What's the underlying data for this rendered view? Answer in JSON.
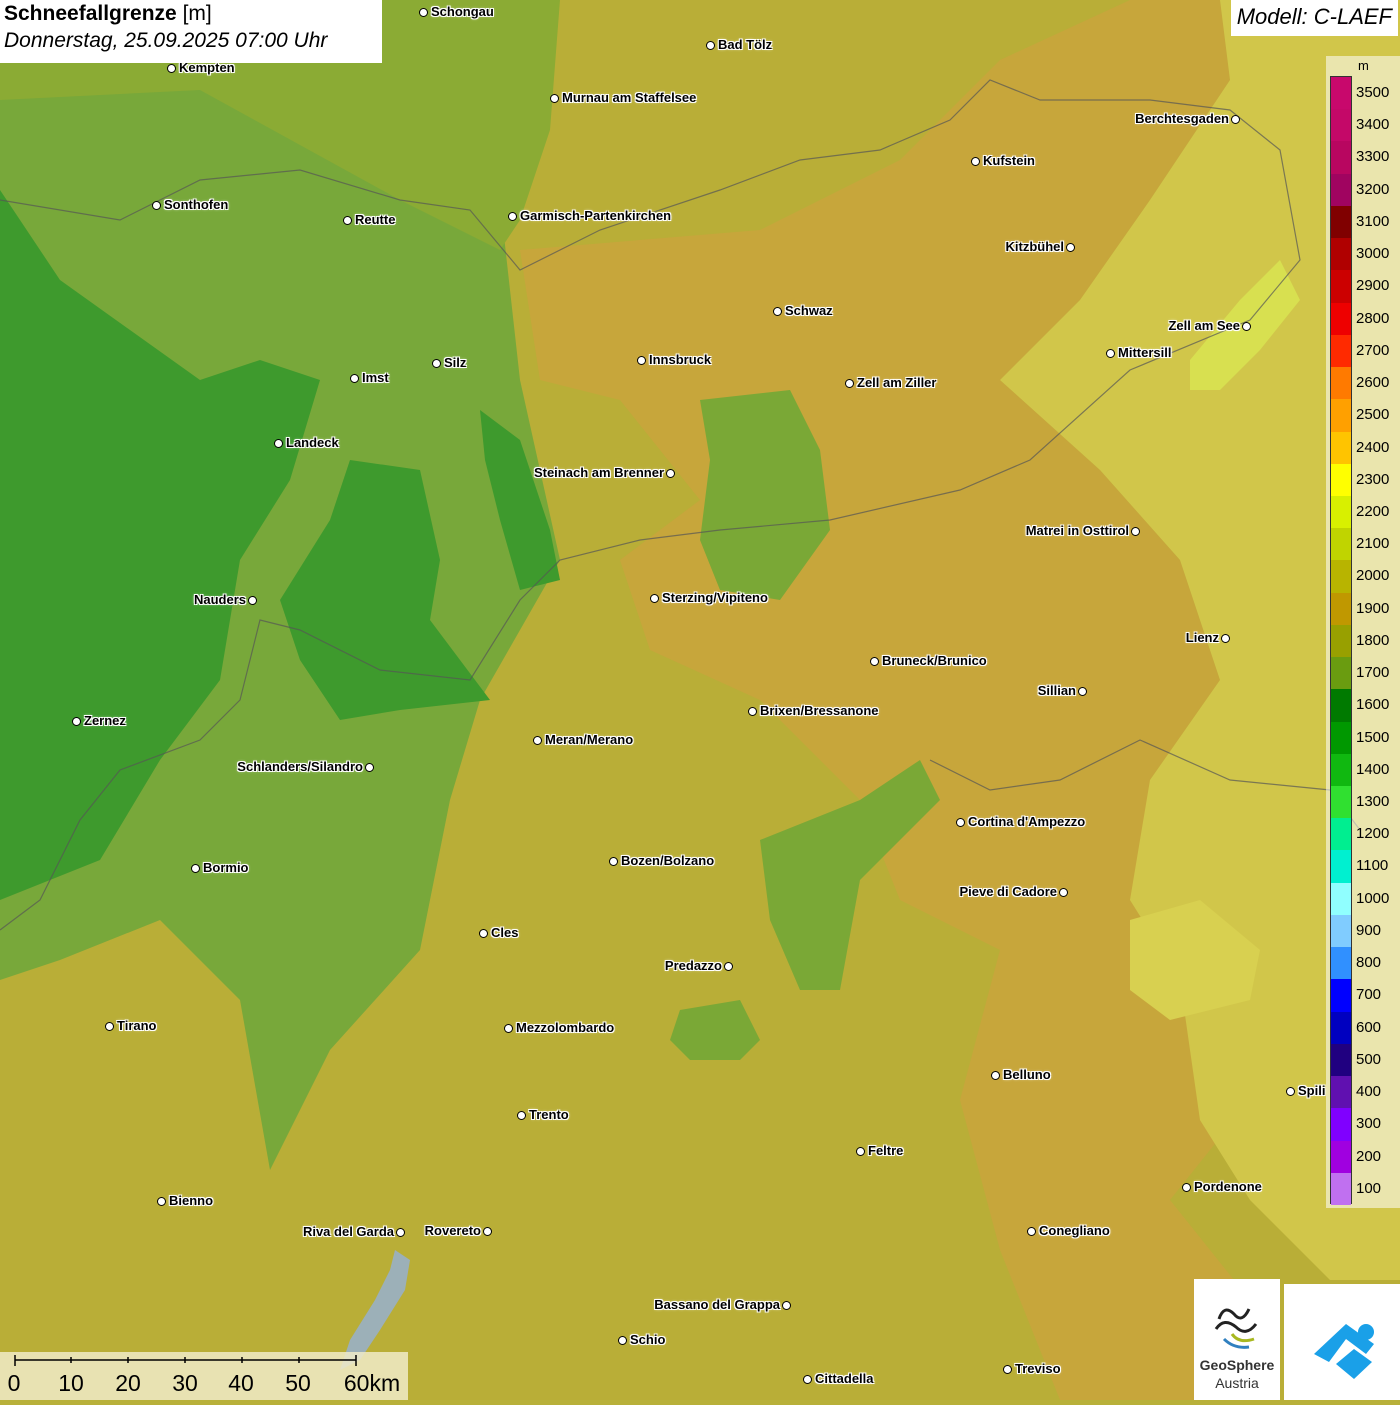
{
  "title": {
    "main": "Schneefallgrenze",
    "unit": "[m]",
    "datetime": "Donnerstag, 25.09.2025 07:00 Uhr"
  },
  "model": "Modell: C-LAEF",
  "legend": {
    "unit": "m",
    "levels": [
      {
        "label": "3500",
        "color": "#c8086c"
      },
      {
        "label": "3400",
        "color": "#c40868"
      },
      {
        "label": "3300",
        "color": "#b80660"
      },
      {
        "label": "3200",
        "color": "#a00460"
      },
      {
        "label": "3100",
        "color": "#800000"
      },
      {
        "label": "3000",
        "color": "#b00000"
      },
      {
        "label": "2900",
        "color": "#cc0000"
      },
      {
        "label": "2800",
        "color": "#ee0000"
      },
      {
        "label": "2700",
        "color": "#ff2a00"
      },
      {
        "label": "2600",
        "color": "#ff7a00"
      },
      {
        "label": "2500",
        "color": "#ffa000"
      },
      {
        "label": "2400",
        "color": "#ffc400"
      },
      {
        "label": "2300",
        "color": "#ffff00"
      },
      {
        "label": "2200",
        "color": "#d8f000"
      },
      {
        "label": "2100",
        "color": "#c0d400"
      },
      {
        "label": "2000",
        "color": "#b8b400"
      },
      {
        "label": "1900",
        "color": "#c09800"
      },
      {
        "label": "1800",
        "color": "#98a000"
      },
      {
        "label": "1700",
        "color": "#6a9c10"
      },
      {
        "label": "1600",
        "color": "#007a00"
      },
      {
        "label": "1500",
        "color": "#009800"
      },
      {
        "label": "1400",
        "color": "#10b810"
      },
      {
        "label": "1300",
        "color": "#30e030"
      },
      {
        "label": "1200",
        "color": "#00ee90"
      },
      {
        "label": "1100",
        "color": "#00f0d0"
      },
      {
        "label": "1000",
        "color": "#90ffff"
      },
      {
        "label": "900",
        "color": "#80ccff"
      },
      {
        "label": "800",
        "color": "#3090ff"
      },
      {
        "label": "700",
        "color": "#0000ff"
      },
      {
        "label": "600",
        "color": "#0000c0"
      },
      {
        "label": "500",
        "color": "#200080"
      },
      {
        "label": "400",
        "color": "#6010b0"
      },
      {
        "label": "300",
        "color": "#8000ff"
      },
      {
        "label": "200",
        "color": "#a000e0"
      },
      {
        "label": "100",
        "color": "#c070f0"
      }
    ]
  },
  "cities": [
    {
      "name": "Schongau"
    },
    {
      "name": "Bad Tölz"
    },
    {
      "name": "Kempten"
    },
    {
      "name": "Murnau am Staffelsee"
    },
    {
      "name": "Kufstein"
    },
    {
      "name": "Berchtesgaden"
    },
    {
      "name": "Sonthofen"
    },
    {
      "name": "Reutte"
    },
    {
      "name": "Garmisch-Partenkirchen"
    },
    {
      "name": "Kitzbühel"
    },
    {
      "name": "Schwaz"
    },
    {
      "name": "Zell am See"
    },
    {
      "name": "Innsbruck"
    },
    {
      "name": "Mittersill"
    },
    {
      "name": "Imst"
    },
    {
      "name": "Silz"
    },
    {
      "name": "Zell am Ziller"
    },
    {
      "name": "Landeck"
    },
    {
      "name": "Steinach am Brenner"
    },
    {
      "name": "Matrei in Osttirol"
    },
    {
      "name": "Nauders"
    },
    {
      "name": "Sterzing/Vipiteno"
    },
    {
      "name": "Lienz"
    },
    {
      "name": "Bruneck/Brunico"
    },
    {
      "name": "Sillian"
    },
    {
      "name": "Zernez"
    },
    {
      "name": "Brixen/Bressanone"
    },
    {
      "name": "Meran/Merano"
    },
    {
      "name": "Schlanders/Silandro"
    },
    {
      "name": "Cortina d'Ampezzo"
    },
    {
      "name": "Bormio"
    },
    {
      "name": "Bozen/Bolzano"
    },
    {
      "name": "Pieve di Cadore"
    },
    {
      "name": "Cles"
    },
    {
      "name": "Predazzo"
    },
    {
      "name": "Tirano"
    },
    {
      "name": "Mezzolombardo"
    },
    {
      "name": "Belluno"
    },
    {
      "name": "Spili"
    },
    {
      "name": "Trento"
    },
    {
      "name": "Feltre"
    },
    {
      "name": "Pordenone"
    },
    {
      "name": "Bienno"
    },
    {
      "name": "Riva del Garda"
    },
    {
      "name": "Rovereto"
    },
    {
      "name": "Conegliano"
    },
    {
      "name": "Bassano del Grappa"
    },
    {
      "name": "Schio"
    },
    {
      "name": "Treviso"
    },
    {
      "name": "Cittadella"
    }
  ],
  "scale": {
    "labels": [
      "0",
      "10",
      "20",
      "30",
      "40",
      "50",
      "60km"
    ]
  },
  "logo": {
    "line1": "GeoSphere",
    "line2": "Austria"
  },
  "colors": {
    "green_dark": "#3f9a2c",
    "green": "#6aa633",
    "olive": "#a7ad35",
    "ochre": "#c7a43a"
  }
}
